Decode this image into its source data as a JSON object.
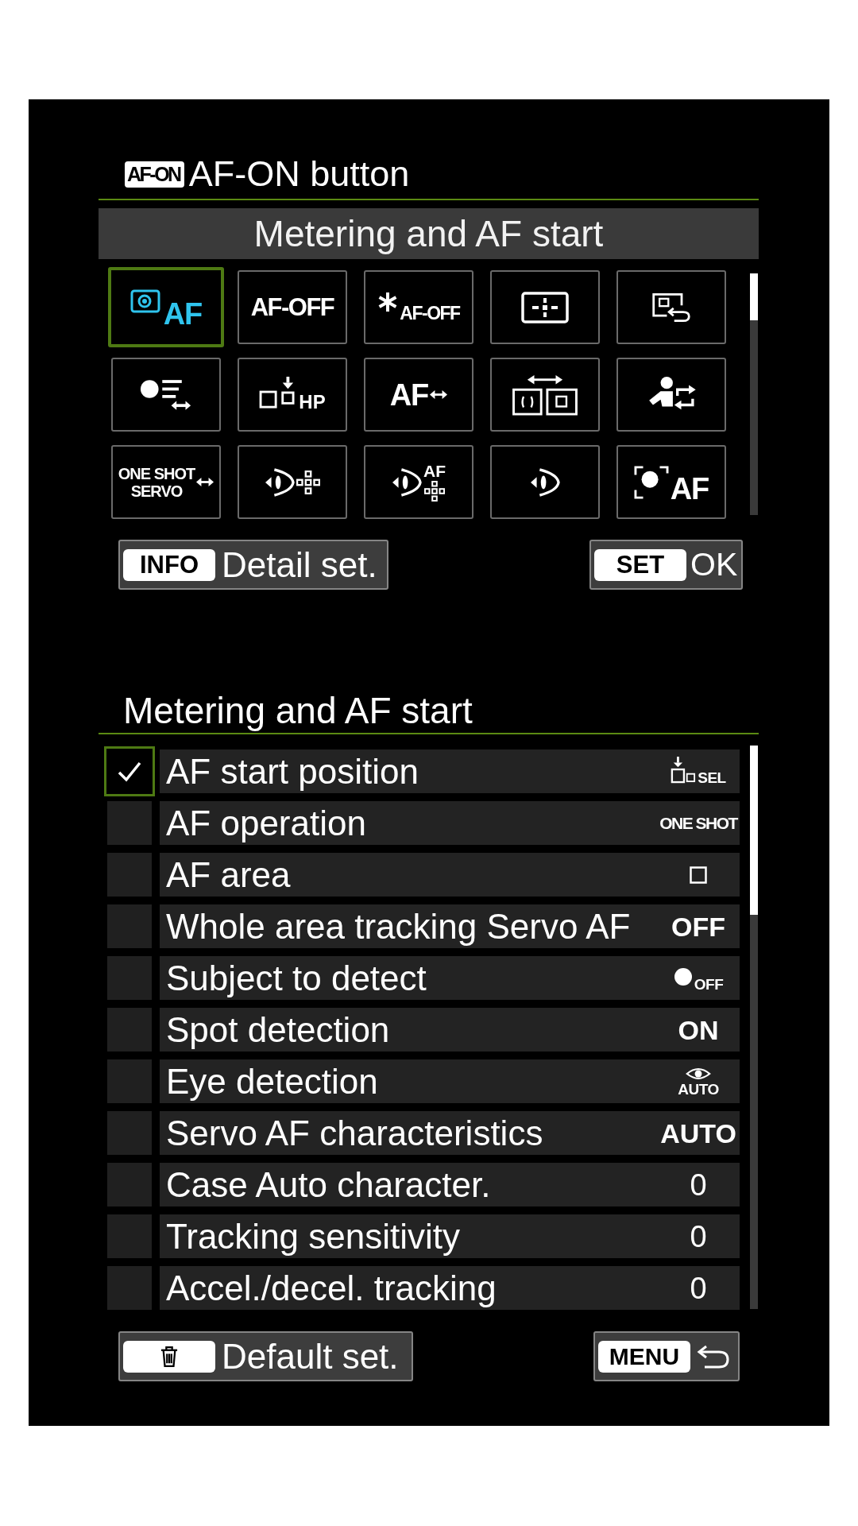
{
  "screen": {
    "key_label": "AF-ON",
    "title": "AF-ON button"
  },
  "function_header": "Metering and AF start",
  "function_tiles": [
    {
      "kind": "subject-frame-af",
      "text": "AF",
      "selected": true
    },
    {
      "kind": "text",
      "text": "AF-OFF",
      "selected": false
    },
    {
      "kind": "asterisk-text",
      "text": "AF-OFF",
      "selected": false
    },
    {
      "kind": "points-frame",
      "selected": false
    },
    {
      "kind": "frame-return",
      "selected": false
    },
    {
      "kind": "metering",
      "selected": false
    },
    {
      "kind": "hp",
      "text": "HP",
      "selected": false
    },
    {
      "kind": "af-switch",
      "text": "AF",
      "selected": false
    },
    {
      "kind": "area-switch",
      "selected": false
    },
    {
      "kind": "subject-switch",
      "selected": false
    },
    {
      "kind": "oneshot-servo",
      "lines": [
        "ONE SHOT",
        "SERVO"
      ],
      "selected": false
    },
    {
      "kind": "eye-points",
      "selected": false
    },
    {
      "kind": "eye-af-points",
      "text": "AF",
      "selected": false
    },
    {
      "kind": "eye",
      "selected": false
    },
    {
      "kind": "subject-af",
      "text": "AF",
      "selected": false
    }
  ],
  "top_buttons": [
    {
      "kind": "info",
      "key": "INFO",
      "label": "Detail set."
    },
    {
      "kind": "set",
      "key": "SET",
      "label": "OK"
    }
  ],
  "settings": {
    "title": "Metering and AF start",
    "rows": [
      {
        "name": "AF start position",
        "checked": true,
        "selected": true,
        "value": {
          "kind": "start-pos",
          "text": "SEL"
        }
      },
      {
        "name": "AF operation",
        "checked": false,
        "selected": false,
        "value": {
          "kind": "condensed",
          "text": "ONE SHOT"
        }
      },
      {
        "name": "AF area",
        "checked": false,
        "selected": false,
        "value": {
          "kind": "square"
        }
      },
      {
        "name": "Whole area tracking Servo AF",
        "checked": false,
        "selected": false,
        "value": {
          "kind": "bold",
          "text": "OFF"
        }
      },
      {
        "name": "Subject to detect",
        "checked": false,
        "selected": false,
        "value": {
          "kind": "subject",
          "text": "OFF"
        }
      },
      {
        "name": "Spot detection",
        "checked": false,
        "selected": false,
        "value": {
          "kind": "bold",
          "text": "ON"
        }
      },
      {
        "name": "Eye detection",
        "checked": false,
        "selected": false,
        "value": {
          "kind": "eye-auto",
          "text": "AUTO"
        }
      },
      {
        "name": "Servo AF characteristics",
        "checked": false,
        "selected": false,
        "value": {
          "kind": "bold",
          "text": "AUTO"
        }
      },
      {
        "name": "Case Auto character.",
        "checked": false,
        "selected": false,
        "value": {
          "kind": "plain",
          "text": "0"
        }
      },
      {
        "name": "Tracking sensitivity",
        "checked": false,
        "selected": false,
        "value": {
          "kind": "plain",
          "text": "0"
        }
      },
      {
        "name": "Accel./decel. tracking",
        "checked": false,
        "selected": false,
        "value": {
          "kind": "plain",
          "text": "0"
        }
      }
    ]
  },
  "bottom_buttons": [
    {
      "kind": "erase",
      "label": "Default set."
    },
    {
      "kind": "menu",
      "key": "MENU"
    }
  ]
}
